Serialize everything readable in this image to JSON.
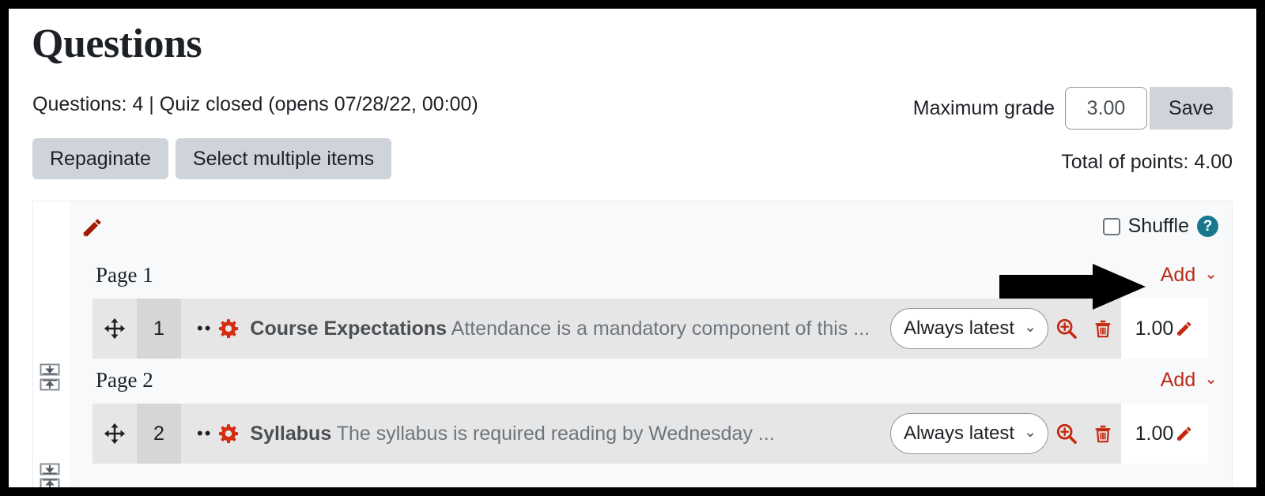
{
  "header": {
    "title": "Questions",
    "meta": "Questions: 4 | Quiz closed (opens 07/28/22, 00:00)",
    "repaginate_label": "Repaginate",
    "select_multiple_label": "Select multiple items",
    "maximum_grade_label": "Maximum grade",
    "maximum_grade_value": "3.00",
    "maximum_grade_placeholder": "3.00",
    "save_label": "Save",
    "total_points": "Total of points: 4.00"
  },
  "panel": {
    "edit_icon": "pencil-icon",
    "shuffle_label": "Shuffle",
    "shuffle_checked": false,
    "help_glyph": "?",
    "add_label": "Add",
    "chevron_glyph": "⌄"
  },
  "pages": [
    {
      "label": "Page 1",
      "add_label": "Add"
    },
    {
      "label": "Page 2",
      "add_label": "Add"
    }
  ],
  "questions": [
    {
      "number": "1",
      "name": "Course Expectations",
      "preview": "Attendance is a mandatory component of this ...",
      "version_label": "Always latest",
      "mark": "1.00"
    },
    {
      "number": "2",
      "name": "Syllabus",
      "preview": "The syllabus is required reading by Wednesday ...",
      "version_label": "Always latest",
      "mark": "1.00"
    }
  ],
  "colors": {
    "accent_red": "#ba2b15",
    "gear_red": "#d62d10",
    "help_teal": "#17788d",
    "button_gray": "#ced4da",
    "row_gray": "#e6e6e6",
    "panel_gray": "#f8f9fa"
  },
  "annotation": {
    "arrow": "right-arrow-annotation"
  }
}
